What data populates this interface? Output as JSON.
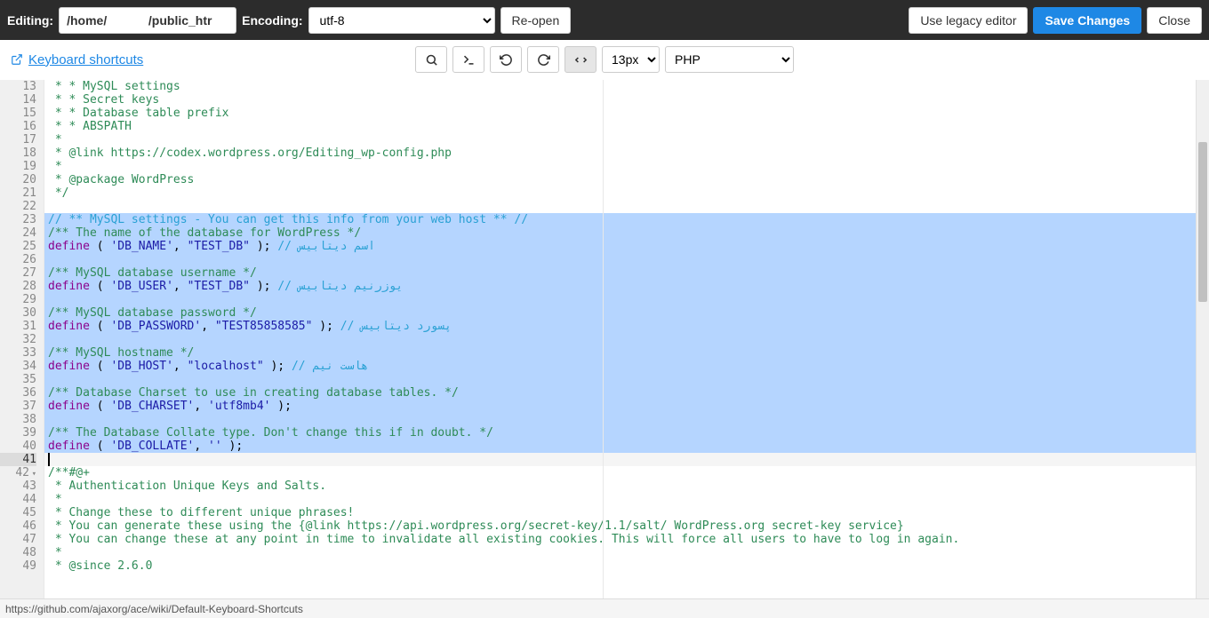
{
  "header": {
    "editing_label": "Editing:",
    "path_value": "/home/            /public_htr",
    "encoding_label": "Encoding:",
    "encoding_value": "utf-8",
    "reopen": "Re-open",
    "legacy": "Use legacy editor",
    "save": "Save Changes",
    "close": "Close"
  },
  "toolbar": {
    "keyboard_shortcuts": "Keyboard shortcuts",
    "font_size": "13px",
    "language": "PHP"
  },
  "gutter": {
    "start": 13,
    "end": 49,
    "active": 41,
    "fold_at": 42
  },
  "selection": {
    "start": 23,
    "end": 40
  },
  "code": [
    {
      "n": 13,
      "t": [
        [
          "comment",
          " * * MySQL settings"
        ]
      ]
    },
    {
      "n": 14,
      "t": [
        [
          "comment",
          " * * Secret keys"
        ]
      ]
    },
    {
      "n": 15,
      "t": [
        [
          "comment",
          " * * Database table prefix"
        ]
      ]
    },
    {
      "n": 16,
      "t": [
        [
          "comment",
          " * * ABSPATH"
        ]
      ]
    },
    {
      "n": 17,
      "t": [
        [
          "comment",
          " *"
        ]
      ]
    },
    {
      "n": 18,
      "t": [
        [
          "comment",
          " * @link https://codex.wordpress.org/Editing_wp-config.php"
        ]
      ]
    },
    {
      "n": 19,
      "t": [
        [
          "comment",
          " *"
        ]
      ]
    },
    {
      "n": 20,
      "t": [
        [
          "comment",
          " * @package WordPress"
        ]
      ]
    },
    {
      "n": 21,
      "t": [
        [
          "comment",
          " */"
        ]
      ]
    },
    {
      "n": 22,
      "t": [
        [
          "",
          ""
        ]
      ]
    },
    {
      "n": 23,
      "t": [
        [
          "ltblue",
          "// ** MySQL settings - You can get this info from your web host ** //"
        ]
      ]
    },
    {
      "n": 24,
      "t": [
        [
          "comment",
          "/** The name of the database for WordPress */"
        ]
      ]
    },
    {
      "n": 25,
      "t": [
        [
          "func",
          "define"
        ],
        [
          "",
          " ( "
        ],
        [
          "string",
          "'DB_NAME'"
        ],
        [
          "",
          ", "
        ],
        [
          "string",
          "\"TEST_DB\""
        ],
        [
          "",
          " ); "
        ],
        [
          "ltblue",
          "// اسم دیتابیس"
        ]
      ]
    },
    {
      "n": 26,
      "t": [
        [
          "",
          ""
        ]
      ]
    },
    {
      "n": 27,
      "t": [
        [
          "comment",
          "/** MySQL database username */"
        ]
      ]
    },
    {
      "n": 28,
      "t": [
        [
          "func",
          "define"
        ],
        [
          "",
          " ( "
        ],
        [
          "string",
          "'DB_USER'"
        ],
        [
          "",
          ", "
        ],
        [
          "string",
          "\"TEST_DB\""
        ],
        [
          "",
          " ); "
        ],
        [
          "ltblue",
          "// یوزرنیم دیتابیس"
        ]
      ]
    },
    {
      "n": 29,
      "t": [
        [
          "",
          ""
        ]
      ]
    },
    {
      "n": 30,
      "t": [
        [
          "comment",
          "/** MySQL database password */"
        ]
      ]
    },
    {
      "n": 31,
      "t": [
        [
          "func",
          "define"
        ],
        [
          "",
          " ( "
        ],
        [
          "string",
          "'DB_PASSWORD'"
        ],
        [
          "",
          ", "
        ],
        [
          "string",
          "\"TEST85858585\""
        ],
        [
          "",
          " ); "
        ],
        [
          "ltblue",
          "// پسورد دیتابیس"
        ]
      ]
    },
    {
      "n": 32,
      "t": [
        [
          "",
          ""
        ]
      ]
    },
    {
      "n": 33,
      "t": [
        [
          "comment",
          "/** MySQL hostname */"
        ]
      ]
    },
    {
      "n": 34,
      "t": [
        [
          "func",
          "define"
        ],
        [
          "",
          " ( "
        ],
        [
          "string",
          "'DB_HOST'"
        ],
        [
          "",
          ", "
        ],
        [
          "string",
          "\"localhost\""
        ],
        [
          "",
          " ); "
        ],
        [
          "ltblue",
          "// هاست نیم"
        ]
      ]
    },
    {
      "n": 35,
      "t": [
        [
          "",
          ""
        ]
      ]
    },
    {
      "n": 36,
      "t": [
        [
          "comment",
          "/** Database Charset to use in creating database tables. */"
        ]
      ]
    },
    {
      "n": 37,
      "t": [
        [
          "func",
          "define"
        ],
        [
          "",
          " ( "
        ],
        [
          "string",
          "'DB_CHARSET'"
        ],
        [
          "",
          ", "
        ],
        [
          "string",
          "'utf8mb4'"
        ],
        [
          "",
          " );"
        ]
      ]
    },
    {
      "n": 38,
      "t": [
        [
          "",
          ""
        ]
      ]
    },
    {
      "n": 39,
      "t": [
        [
          "comment",
          "/** The Database Collate type. Don't change this if in doubt. */"
        ]
      ]
    },
    {
      "n": 40,
      "t": [
        [
          "func",
          "define"
        ],
        [
          "",
          " ( "
        ],
        [
          "string",
          "'DB_COLLATE'"
        ],
        [
          "",
          ", "
        ],
        [
          "string",
          "''"
        ],
        [
          "",
          " );"
        ]
      ]
    },
    {
      "n": 41,
      "t": [
        [
          "",
          ""
        ]
      ]
    },
    {
      "n": 42,
      "t": [
        [
          "comment",
          "/**#@+"
        ]
      ]
    },
    {
      "n": 43,
      "t": [
        [
          "comment",
          " * Authentication Unique Keys and Salts."
        ]
      ]
    },
    {
      "n": 44,
      "t": [
        [
          "comment",
          " *"
        ]
      ]
    },
    {
      "n": 45,
      "t": [
        [
          "comment",
          " * Change these to different unique phrases!"
        ]
      ]
    },
    {
      "n": 46,
      "t": [
        [
          "comment",
          " * You can generate these using the {@link https://api.wordpress.org/secret-key/1.1/salt/ WordPress.org secret-key service}"
        ]
      ]
    },
    {
      "n": 47,
      "t": [
        [
          "comment",
          " * You can change these at any point in time to invalidate all existing cookies. This will force all users to have to log in again."
        ]
      ]
    },
    {
      "n": 48,
      "t": [
        [
          "comment",
          " *"
        ]
      ]
    },
    {
      "n": 49,
      "t": [
        [
          "comment",
          " * @since 2.6.0"
        ]
      ]
    }
  ],
  "statusbar": {
    "link": "https://github.com/ajaxorg/ace/wiki/Default-Keyboard-Shortcuts"
  }
}
